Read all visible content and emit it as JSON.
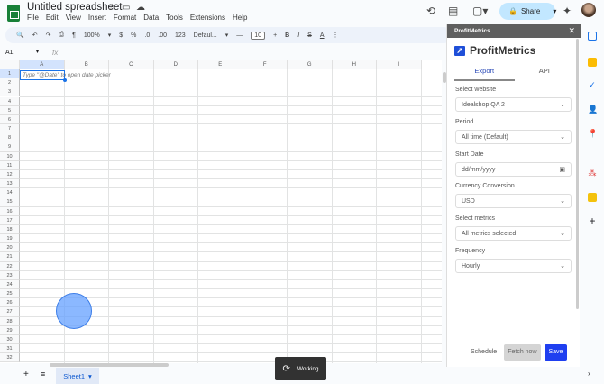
{
  "doc": {
    "title": "Untitled spreadsheet",
    "menu": [
      "File",
      "Edit",
      "View",
      "Insert",
      "Format",
      "Data",
      "Tools",
      "Extensions",
      "Help"
    ]
  },
  "header": {
    "share_label": "Share"
  },
  "toolbar": {
    "zoom": "100%",
    "currency": "$",
    "percent": "%",
    "dec_decrease": ".0",
    "dec_increase": ".00",
    "format_123": "123",
    "font": "Defaul...",
    "font_size": "10",
    "bold": "B",
    "italic": "I",
    "strike": "S",
    "text_color": "A"
  },
  "formula": {
    "namebox": "A1",
    "fx": "fx"
  },
  "grid": {
    "columns": [
      "A",
      "B",
      "C",
      "D",
      "E",
      "F",
      "G",
      "H",
      "I"
    ],
    "rows": 32,
    "a1_hint": "Type \"@Date\" to open date picker"
  },
  "sheets": {
    "tabs": [
      "Sheet1"
    ]
  },
  "toast": {
    "text": "Working"
  },
  "panel": {
    "header": "ProfitMetrics",
    "brand": "ProfitMetrics",
    "tabs": [
      "Export",
      "API"
    ],
    "active_tab": "Export",
    "fields": [
      {
        "label": "Select website",
        "value": "Idealshop QA 2"
      },
      {
        "label": "Period",
        "value": "All time (Default)"
      },
      {
        "label": "Start Date",
        "value": "dd/mm/yyyy"
      },
      {
        "label": "Currency Conversion",
        "value": "USD"
      },
      {
        "label": "Select metrics",
        "value": "All metrics selected"
      },
      {
        "label": "Frequency",
        "value": "Hourly"
      }
    ],
    "buttons": {
      "schedule": "Schedule",
      "fetch": "Fetch now",
      "save": "Save"
    }
  },
  "colors": {
    "accent": "#1a73e8",
    "save": "#1f3ff0",
    "share_bg": "#c2e7ff",
    "panel_header": "#5f5f5f"
  }
}
